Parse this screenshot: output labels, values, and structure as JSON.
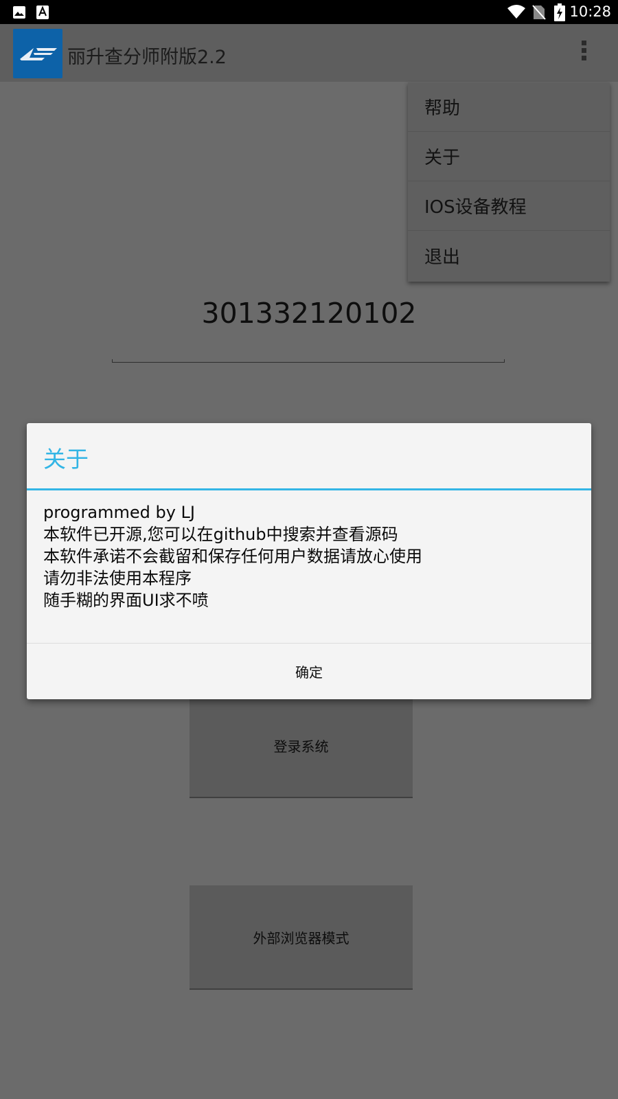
{
  "status_bar": {
    "time": "10:28",
    "icons": [
      "image-icon",
      "font-icon",
      "wifi-icon",
      "no-sim-icon",
      "battery-charging-icon"
    ]
  },
  "action_bar": {
    "title": "丽升查分师附版2.2",
    "logo_text": "LS",
    "overflow_icon": "more-vert-icon"
  },
  "main": {
    "student_id": "301332120102",
    "login_button": "登录系统",
    "browser_button": "外部浏览器模式"
  },
  "menu": {
    "items": [
      {
        "label": "帮助"
      },
      {
        "label": "关于"
      },
      {
        "label": "IOS设备教程"
      },
      {
        "label": "退出"
      }
    ]
  },
  "dialog": {
    "title": "关于",
    "lines": [
      "programmed by LJ",
      "本软件已开源,您可以在github中搜索并查看源码",
      "本软件承诺不会截留和保存任何用户数据请放心使用",
      "请勿非法使用本程序",
      "随手糊的界面UI求不喷"
    ],
    "ok_label": "确定"
  },
  "colors": {
    "accent": "#33b5e5",
    "logo_bg": "#0d62a8",
    "scrim_bg": "#6b6b6b"
  }
}
